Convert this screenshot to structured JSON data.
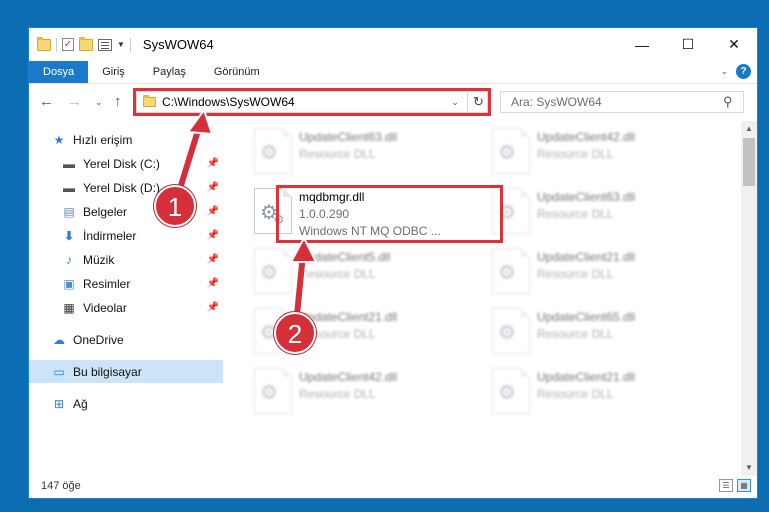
{
  "window": {
    "title": "SysWOW64"
  },
  "window_controls": {
    "minimize": "—",
    "maximize": "☐",
    "close": "✕"
  },
  "ribbon": {
    "tabs": [
      "Dosya",
      "Giriş",
      "Paylaş",
      "Görünüm"
    ],
    "help": "?"
  },
  "address": {
    "path": "C:\\Windows\\SysWOW64",
    "search_placeholder": "Ara: SysWOW64"
  },
  "sidebar": {
    "quick_access": "Hızlı erişim",
    "items": [
      {
        "label": "Yerel Disk (C:)",
        "icon": "drive-icon",
        "pinned": true
      },
      {
        "label": "Yerel Disk (D:)",
        "icon": "drive-icon",
        "pinned": true
      },
      {
        "label": "Belgeler",
        "icon": "documents-icon",
        "pinned": true
      },
      {
        "label": "İndirmeler",
        "icon": "downloads-icon",
        "pinned": true
      },
      {
        "label": "Müzik",
        "icon": "music-icon",
        "pinned": true
      },
      {
        "label": "Resimler",
        "icon": "pictures-icon",
        "pinned": true
      },
      {
        "label": "Videolar",
        "icon": "videos-icon",
        "pinned": true
      }
    ],
    "onedrive": "OneDrive",
    "this_pc": "Bu bilgisayar",
    "network": "Ağ"
  },
  "files": {
    "highlighted": {
      "name": "mqdbmgr.dll",
      "version": "1.0.0.290",
      "description": "Windows NT MQ ODBC ..."
    },
    "blurred": [
      {
        "name": "UpdateClient63.dll",
        "type": "Resource DLL"
      },
      {
        "name": "UpdateClient42.dll",
        "type": "Resource DLL"
      },
      {
        "name": "UpdateClient63.dll",
        "type": "Resource DLL"
      },
      {
        "name": "UpdateClient5.dll",
        "type": "Resource DLL"
      },
      {
        "name": "UpdateClient21.dll",
        "type": "Resource DLL"
      },
      {
        "name": "UpdateClient21.dll",
        "type": "Resource DLL"
      },
      {
        "name": "UpdateClient65.dll",
        "type": "Resource DLL"
      },
      {
        "name": "UpdateClient42.dll",
        "type": "Resource DLL"
      },
      {
        "name": "UpdateClient21.dll",
        "type": "Resource DLL"
      }
    ]
  },
  "status": {
    "count": "147 öğe"
  },
  "annotations": {
    "step1": "1",
    "step2": "2"
  },
  "colors": {
    "accent": "#1979ca",
    "highlight": "#e0303a",
    "desktop": "#0d6db3"
  }
}
